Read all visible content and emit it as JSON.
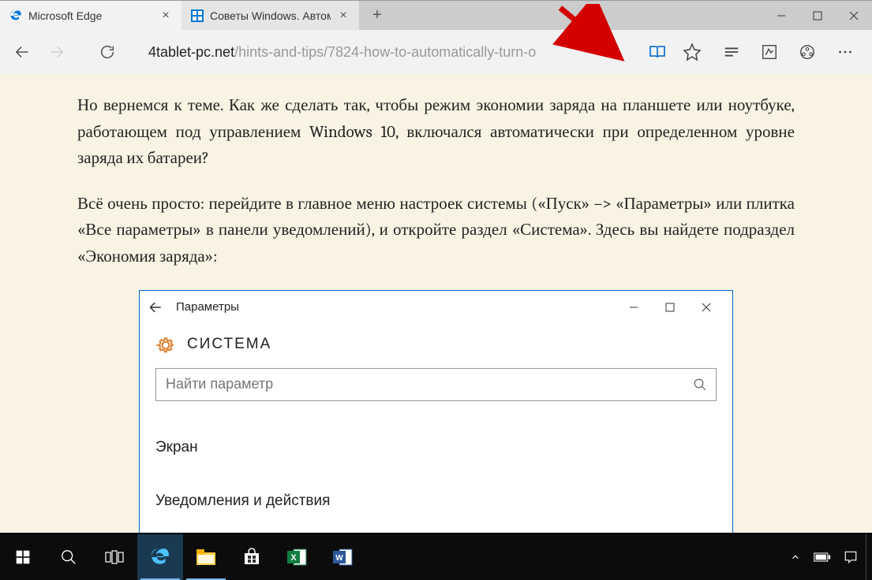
{
  "tabs": [
    {
      "title": "Microsoft Edge"
    },
    {
      "title": "Советы Windows. Автом"
    }
  ],
  "address": {
    "domain": "4tablet-pc.net",
    "path": "/hints-and-tips/7824-how-to-automatically-turn-o"
  },
  "article": {
    "p1": "Но вернемся к теме. Как же сделать так, чтобы режим экономии заряда на план­шете или ноутбуке, работающем под управлением Windows 10, включался автома­тически при определенном уровне заряда их батареи?",
    "p2": "Всё очень просто: перейдите в главное меню настроек системы («Пуск» –> «Пара­метры» или плитка «Все параметры» в панели уведомлений), и откройте раздел «Система». Здесь вы найдете подраздел «Экономия заряда»:"
  },
  "settings": {
    "title": "Параметры",
    "section": "СИСТЕМА",
    "search_placeholder": "Найти параметр",
    "item1": "Экран",
    "item2": "Уведомления и действия"
  }
}
